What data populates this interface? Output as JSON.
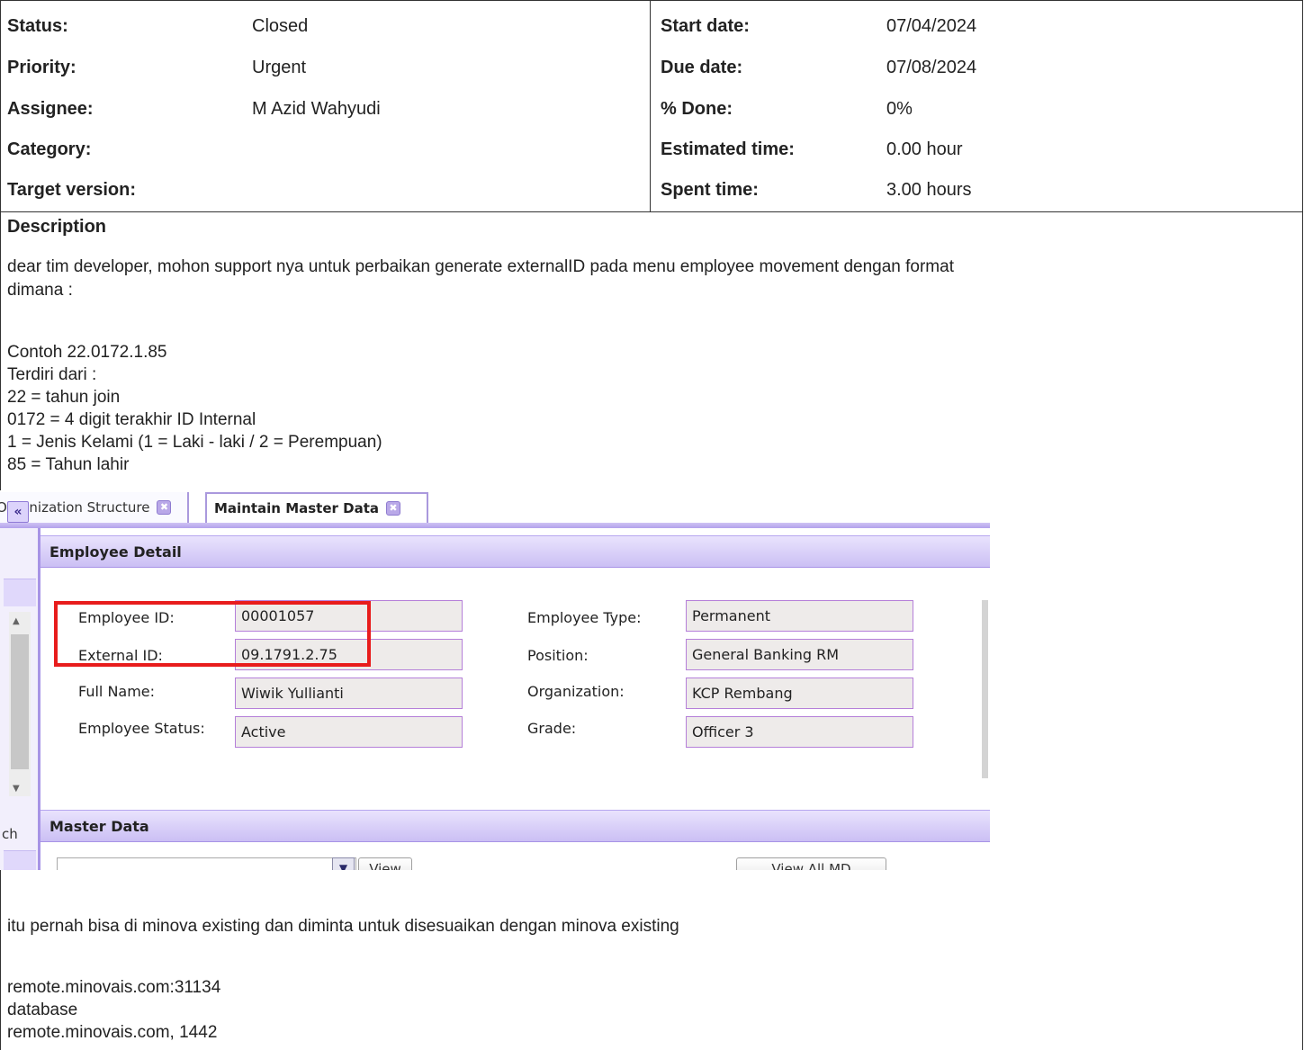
{
  "attributes": {
    "left": [
      {
        "label": "Status:",
        "value": "Closed"
      },
      {
        "label": "Priority:",
        "value": "Urgent"
      },
      {
        "label": "Assignee:",
        "value": "M Azid Wahyudi"
      },
      {
        "label": "Category:",
        "value": ""
      },
      {
        "label": "Target version:",
        "value": ""
      }
    ],
    "right": [
      {
        "label": "Start date:",
        "value": "07/04/2024"
      },
      {
        "label": "Due date:",
        "value": "07/08/2024"
      },
      {
        "label": "% Done:",
        "value": "0%"
      },
      {
        "label": "Estimated time:",
        "value": "0.00 hour"
      },
      {
        "label": "Spent time:",
        "value": "3.00 hours"
      }
    ]
  },
  "description": {
    "heading": "Description",
    "intro": [
      "dear tim developer, mohon support nya untuk perbaikan generate externalID pada menu employee movement dengan format",
      "dimana :"
    ],
    "example": [
      "Contoh 22.0172.1.85",
      "Terdiri dari :",
      "22 = tahun join",
      "0172 = 4 digit terakhir ID Internal",
      "1 = Jenis Kelami (1 = Laki - laki / 2 = Perempuan)",
      "85 = Tahun lahir"
    ],
    "after": [
      "itu pernah bisa di minova existing dan diminta untuk disesuaikan dengan minova existing",
      "remote.minovais.com:31134",
      "database",
      "remote.minovais.com, 1442"
    ]
  },
  "screenshot": {
    "tabs": [
      {
        "label": "Organization Structure"
      },
      {
        "label": "Maintain Master Data"
      }
    ],
    "close_glyph": "✖",
    "collapse_glyph": "«",
    "strip_text": "ch",
    "employee_detail": {
      "title": "Employee Detail",
      "fields_left": [
        {
          "label": "Employee ID:",
          "value": "00001057"
        },
        {
          "label": "External ID:",
          "value": "09.1791.2.75"
        },
        {
          "label": "Full Name:",
          "value": "Wiwik Yullianti"
        },
        {
          "label": "Employee Status:",
          "value": "Active"
        }
      ],
      "fields_right": [
        {
          "label": "Employee Type:",
          "value": "Permanent"
        },
        {
          "label": "Position:",
          "value": "General Banking RM"
        },
        {
          "label": "Organization:",
          "value": "KCP Rembang"
        },
        {
          "label": "Grade:",
          "value": "Officer 3"
        }
      ]
    },
    "master_data": {
      "title": "Master Data",
      "view_button": "View",
      "view_all_button": "View All MD"
    }
  }
}
